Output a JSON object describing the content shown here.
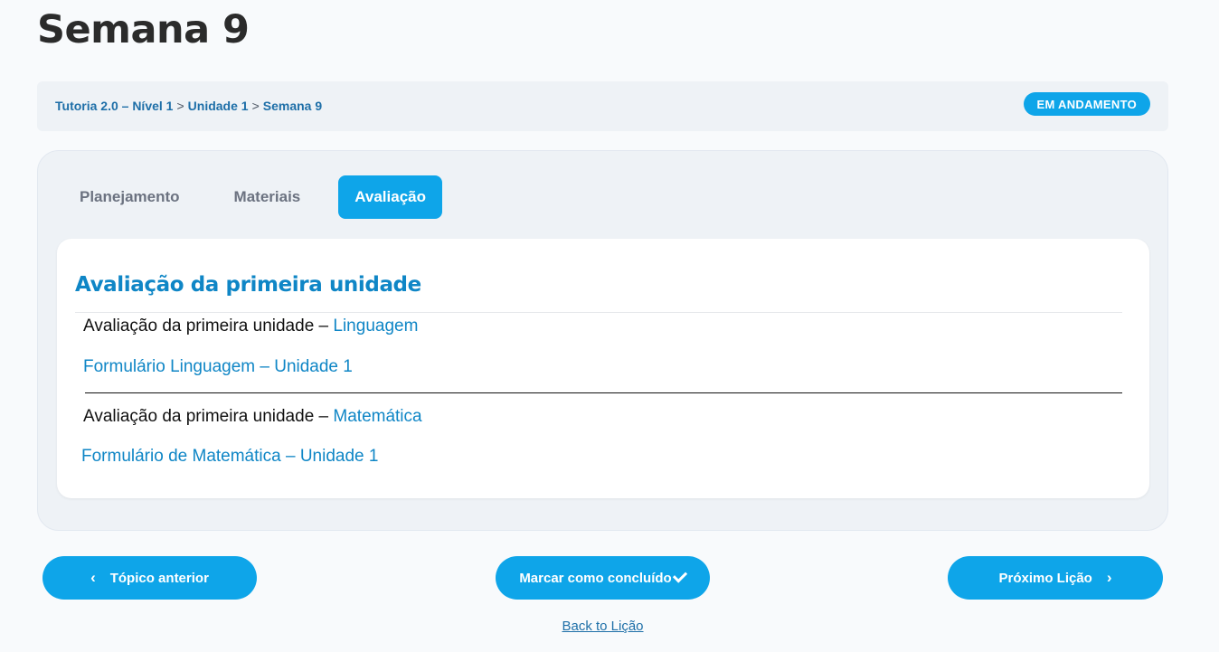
{
  "page": {
    "title": "Semana 9"
  },
  "breadcrumb": {
    "items": [
      "Tutoria 2.0 – Nível 1",
      "Unidade 1",
      "Semana 9"
    ],
    "separator": ">"
  },
  "status": {
    "label": "EM ANDAMENTO",
    "color": "#0ea5e9"
  },
  "tabs": [
    {
      "label": "Planejamento",
      "active": false
    },
    {
      "label": "Materiais",
      "active": false
    },
    {
      "label": "Avaliação",
      "active": true
    }
  ],
  "content": {
    "section_title": "Avaliação da primeira unidade",
    "items": [
      {
        "heading_prefix": "Avaliação da primeira unidade – ",
        "heading_subject": "Linguagem",
        "link": "Formulário Linguagem – Unidade 1"
      },
      {
        "heading_prefix": "Avaliação da primeira unidade – ",
        "heading_subject": "Matemática",
        "link": "Formulário de Matemática – Unidade 1"
      }
    ]
  },
  "nav": {
    "prev_label": "Tópico anterior",
    "prev_icon": "chevron-left-icon",
    "complete_label": "Marcar como concluído",
    "complete_icon": "check-icon",
    "next_label": "Próximo Lição",
    "next_icon": "chevron-right-icon",
    "back_label": "Back to Lição"
  },
  "colors": {
    "accent": "#0ea5e9",
    "link": "#0f86c6",
    "breadcrumb": "#1e6fa8"
  }
}
